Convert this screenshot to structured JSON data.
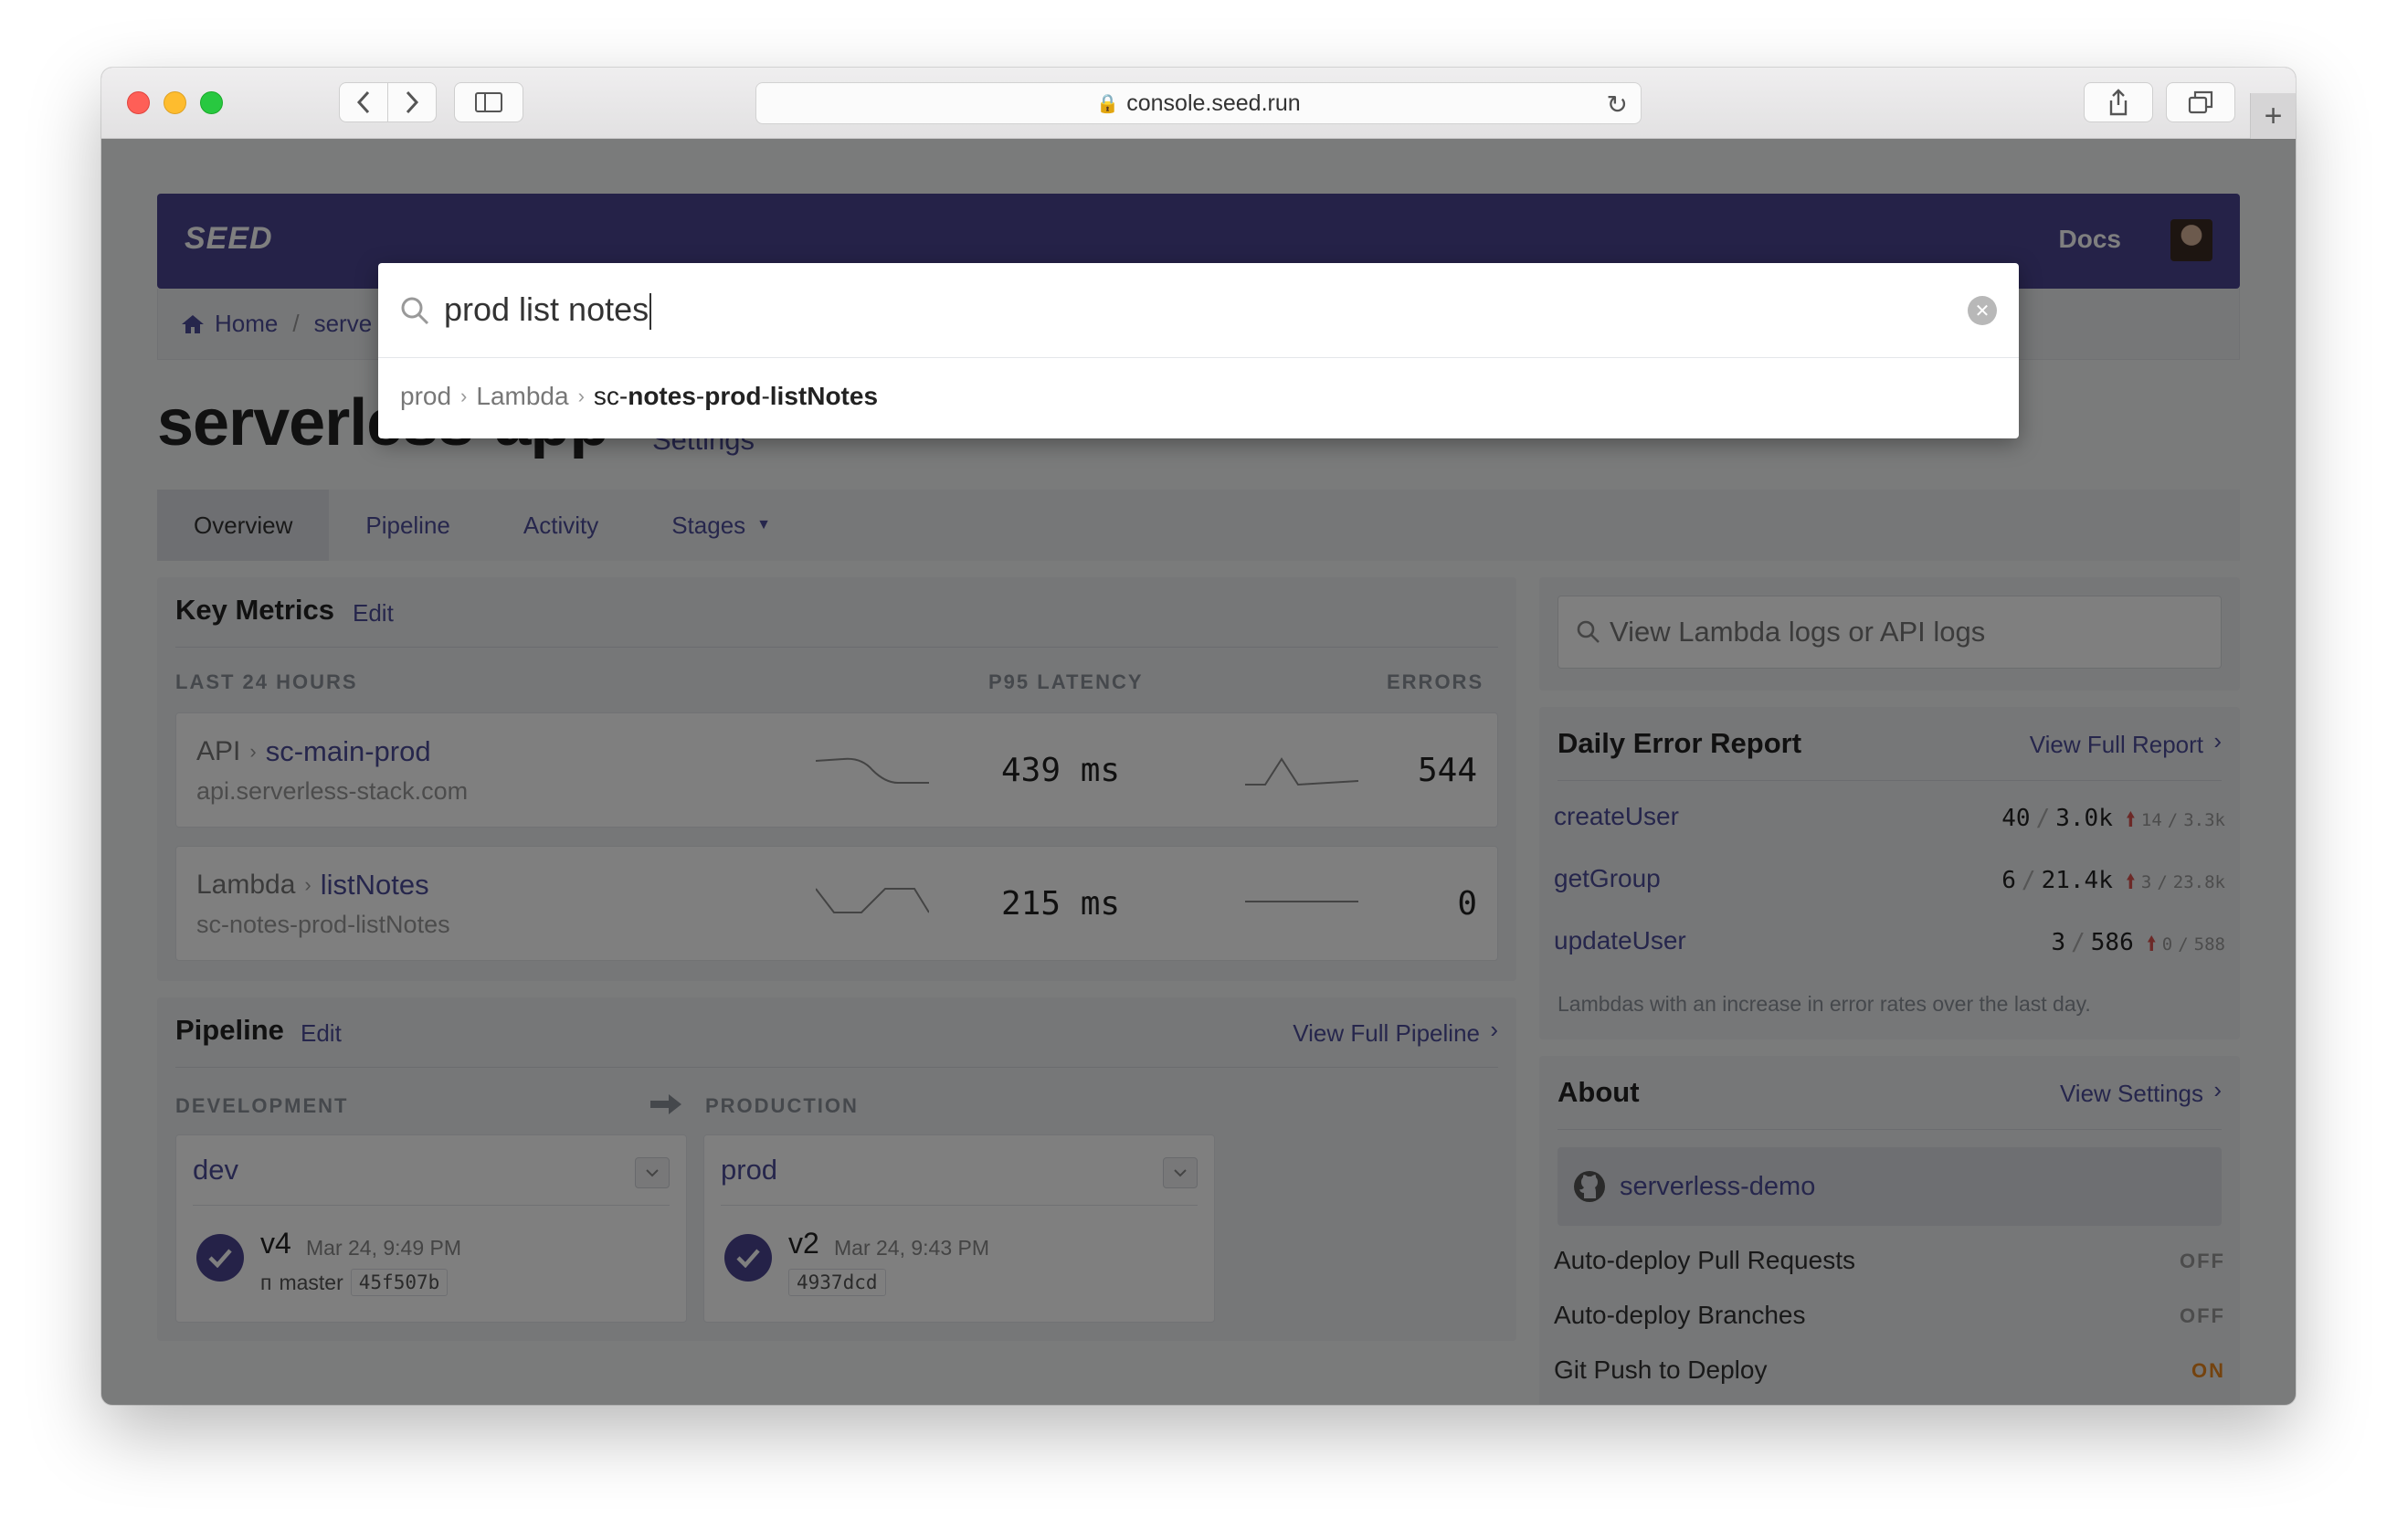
{
  "browser": {
    "url": "console.seed.run"
  },
  "nav": {
    "logo": "SEED",
    "docs": "Docs"
  },
  "breadcrumb": {
    "home": "Home",
    "app": "serve"
  },
  "app": {
    "title": "serverless-app",
    "settings_link": "Settings"
  },
  "tabs": [
    {
      "label": "Overview",
      "active": true
    },
    {
      "label": "Pipeline"
    },
    {
      "label": "Activity"
    },
    {
      "label": "Stages"
    }
  ],
  "metrics": {
    "title": "Key Metrics",
    "edit": "Edit",
    "col_period": "LAST 24 HOURS",
    "col_latency": "P95 LATENCY",
    "col_errors": "ERRORS",
    "rows": [
      {
        "type": "API",
        "name": "sc-main-prod",
        "sub": "api.serverless-stack.com",
        "latency": "439 ms",
        "errors": "544"
      },
      {
        "type": "Lambda",
        "name": "listNotes",
        "sub": "sc-notes-prod-listNotes",
        "latency": "215 ms",
        "errors": "0"
      }
    ]
  },
  "pipeline": {
    "title": "Pipeline",
    "edit": "Edit",
    "view_full": "View Full Pipeline",
    "col_dev": "DEVELOPMENT",
    "col_prod": "PRODUCTION",
    "stages": [
      {
        "name": "dev",
        "version": "v4",
        "date": "Mar 24, 9:49 PM",
        "branch": "master",
        "sha": "45f507b"
      },
      {
        "name": "prod",
        "version": "v2",
        "date": "Mar 24, 9:43 PM",
        "sha": "4937dcd"
      }
    ]
  },
  "logs_search": {
    "placeholder": "View Lambda logs or API logs"
  },
  "error_report": {
    "title": "Daily Error Report",
    "view_full": "View Full Report",
    "rows": [
      {
        "name": "createUser",
        "errors": "40",
        "invocations": "3.0k",
        "prev_errors": "14",
        "prev_invocations": "3.3k"
      },
      {
        "name": "getGroup",
        "errors": "6",
        "invocations": "21.4k",
        "prev_errors": "3",
        "prev_invocations": "23.8k"
      },
      {
        "name": "updateUser",
        "errors": "3",
        "invocations": "586",
        "prev_errors": "0",
        "prev_invocations": "588"
      }
    ],
    "note": "Lambdas with an increase in error rates over the last day."
  },
  "about": {
    "title": "About",
    "view_settings": "View Settings",
    "repo": "serverless-demo",
    "settings": [
      {
        "label": "Auto-deploy Pull Requests",
        "value": "OFF"
      },
      {
        "label": "Auto-deploy Branches",
        "value": "OFF"
      },
      {
        "label": "Git Push to Deploy",
        "value": "ON"
      }
    ]
  },
  "search_popup": {
    "query": "prod list notes",
    "result": {
      "stage": "prod",
      "type": "Lambda",
      "name_prefix": "sc-",
      "name_notes": "notes",
      "name_dash1": "-",
      "name_prod": "prod",
      "name_dash2": "-",
      "name_rest": "listNotes"
    }
  },
  "colors": {
    "brand": "#4b4590",
    "link": "#4d4d99",
    "on": "#e8871e",
    "error_up": "#d9534f"
  }
}
